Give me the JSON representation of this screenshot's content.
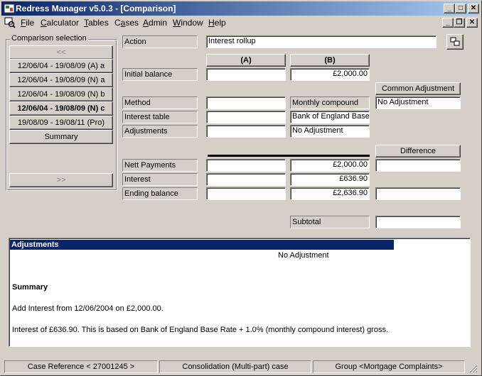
{
  "window": {
    "title": "Redress Manager v5.0.3 - [Comparison]"
  },
  "caption_buttons": {
    "minimize": "_",
    "maximize": "□",
    "close": "✕"
  },
  "mdi_buttons": {
    "minimize": "_",
    "restore": "❐",
    "close": "✕"
  },
  "menu": [
    {
      "label": "File",
      "u": "F",
      "rest": "ile"
    },
    {
      "label": "Calculator",
      "u": "C",
      "rest": "alculator"
    },
    {
      "label": "Tables",
      "u": "T",
      "rest": "ables"
    },
    {
      "label": "Cases",
      "u": "a",
      "prefix": "C",
      "rest": "ses"
    },
    {
      "label": "Admin",
      "u": "A",
      "rest": "dmin"
    },
    {
      "label": "Window",
      "u": "W",
      "rest": "indow"
    },
    {
      "label": "Help",
      "u": "H",
      "rest": "elp"
    }
  ],
  "selection": {
    "legend": "Comparison selection",
    "prev_label": "<<",
    "next_label": ">>",
    "items": [
      {
        "label": "12/06/04 - 19/08/09 (A) a"
      },
      {
        "label": "12/06/04 - 19/08/09 (N) a"
      },
      {
        "label": "12/06/04 - 19/08/09 (N) b"
      },
      {
        "label": "12/06/04 - 19/08/09 (N) c"
      },
      {
        "label": "19/08/09 - 19/08/11 (Pro)"
      },
      {
        "label": "Summary"
      }
    ]
  },
  "form": {
    "action_label": "Action",
    "action_value": "Interest rollup",
    "col_a": "(A)",
    "col_b": "(B)",
    "common_adjustment_header": "Common Adjustment",
    "common_adjustment_value": "No Adjustment",
    "difference_header": "Difference",
    "rows": {
      "initial_balance": {
        "label": "Initial balance",
        "a": "",
        "b": "£2,000.00"
      },
      "method": {
        "label": "Method",
        "a": "",
        "b": "Monthly compound"
      },
      "interest_table": {
        "label": "Interest table",
        "a": "",
        "b": "Bank of England Base"
      },
      "adjustments": {
        "label": "Adjustments",
        "a": "",
        "b": "No Adjustment"
      },
      "nett_payments": {
        "label": "Nett Payments",
        "a": "",
        "b": "£2,000.00",
        "diff": ""
      },
      "interest": {
        "label": "Interest",
        "a": "",
        "b": "£636.90"
      },
      "ending_balance": {
        "label": "Ending balance",
        "a": "",
        "b": "£2,636.90",
        "diff": ""
      }
    },
    "subtotal_label": "Subtotal",
    "subtotal_value": ""
  },
  "details": {
    "adjustments_header": "Adjustments",
    "adjustments_text": "No Adjustment",
    "summary_header": "Summary",
    "line1": "Add Interest from 12/06/2004 on £2,000.00.",
    "line2": "Interest of £636.90. This is based on Bank of England Base Rate + 1.0% (monthly compound interest) gross."
  },
  "status": {
    "case_reference": "Case Reference < 27001245 >",
    "case_type": "Consolidation (Multi-part) case",
    "group": "Group <Mortgage Complaints>"
  },
  "colors": {
    "titlebar": "#0a246a",
    "face": "#d4d0c8",
    "highlight": "#0a246a"
  }
}
